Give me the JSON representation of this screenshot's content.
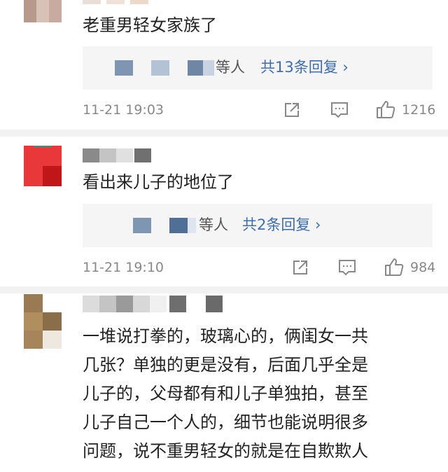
{
  "comments": [
    {
      "text": "老重男轻女家族了",
      "reply_summary": {
        "suffix": "等人",
        "link": "共13条回复 ›"
      },
      "time": "11-21 19:03",
      "likes": "1216"
    },
    {
      "text": "看出来儿子的地位了",
      "reply_summary": {
        "suffix": "等人",
        "link": "共2条回复 ›"
      },
      "time": "11-21 19:10",
      "likes": "984"
    },
    {
      "lines": [
        "一堆说打拳的，玻璃心的，俩闺女一共",
        "几张？单独的更是没有，后面几乎全是",
        "儿子的，父母都有和儿子单独拍，甚至",
        "儿子自己一个人的，细节也能说明很多",
        "问题，说不重男轻女的就是在自欺欺人"
      ]
    }
  ],
  "icons": {
    "share": "share-icon",
    "comment": "comment-icon",
    "like": "thumbs-up-icon"
  }
}
